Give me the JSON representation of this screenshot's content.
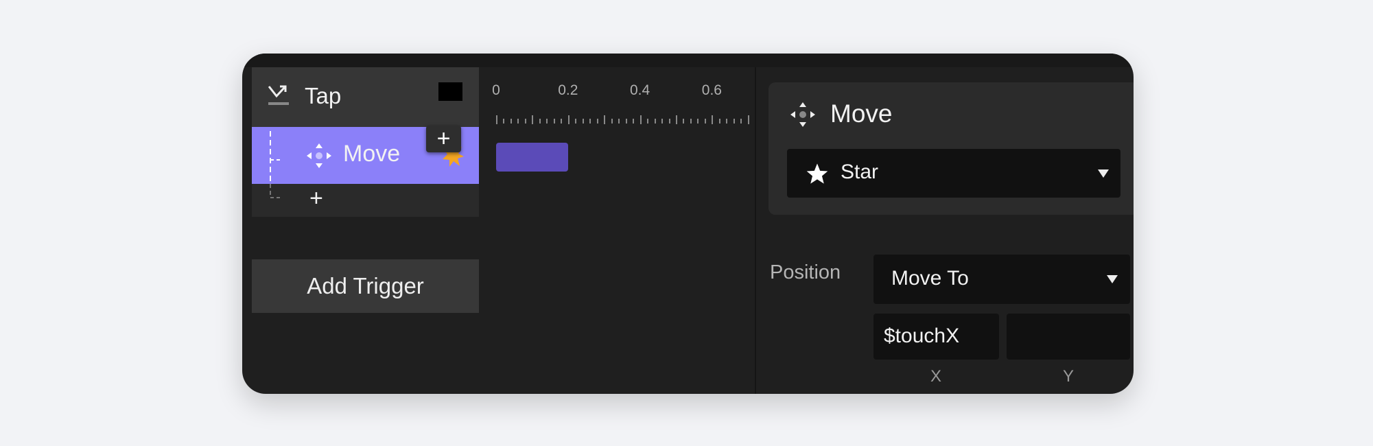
{
  "trigger": {
    "label": "Tap",
    "icon": "tap-gesture-icon",
    "color": "#000000"
  },
  "actions": [
    {
      "label": "Move",
      "icon": "move-arrows-icon",
      "target_icon": "star-burst-icon",
      "target_color": "#f5a623",
      "highlight_color": "#8b80f9"
    }
  ],
  "add_action_label": "+",
  "add_popup_label": "+",
  "add_trigger_label": "Add Trigger",
  "timeline": {
    "ticks": [
      "0",
      "0.2",
      "0.4",
      "0.6"
    ],
    "clips": [
      {
        "action": "Move",
        "start": 0,
        "end": 0.2,
        "color": "#5b4bb8"
      }
    ]
  },
  "inspector": {
    "title": "Move",
    "enabled": true,
    "target": {
      "icon": "star-icon",
      "value": "Star"
    },
    "position": {
      "label": "Position",
      "mode": "Move To",
      "x_value": "$touchX",
      "y_value": "",
      "x_label": "X",
      "y_label": "Y"
    }
  }
}
